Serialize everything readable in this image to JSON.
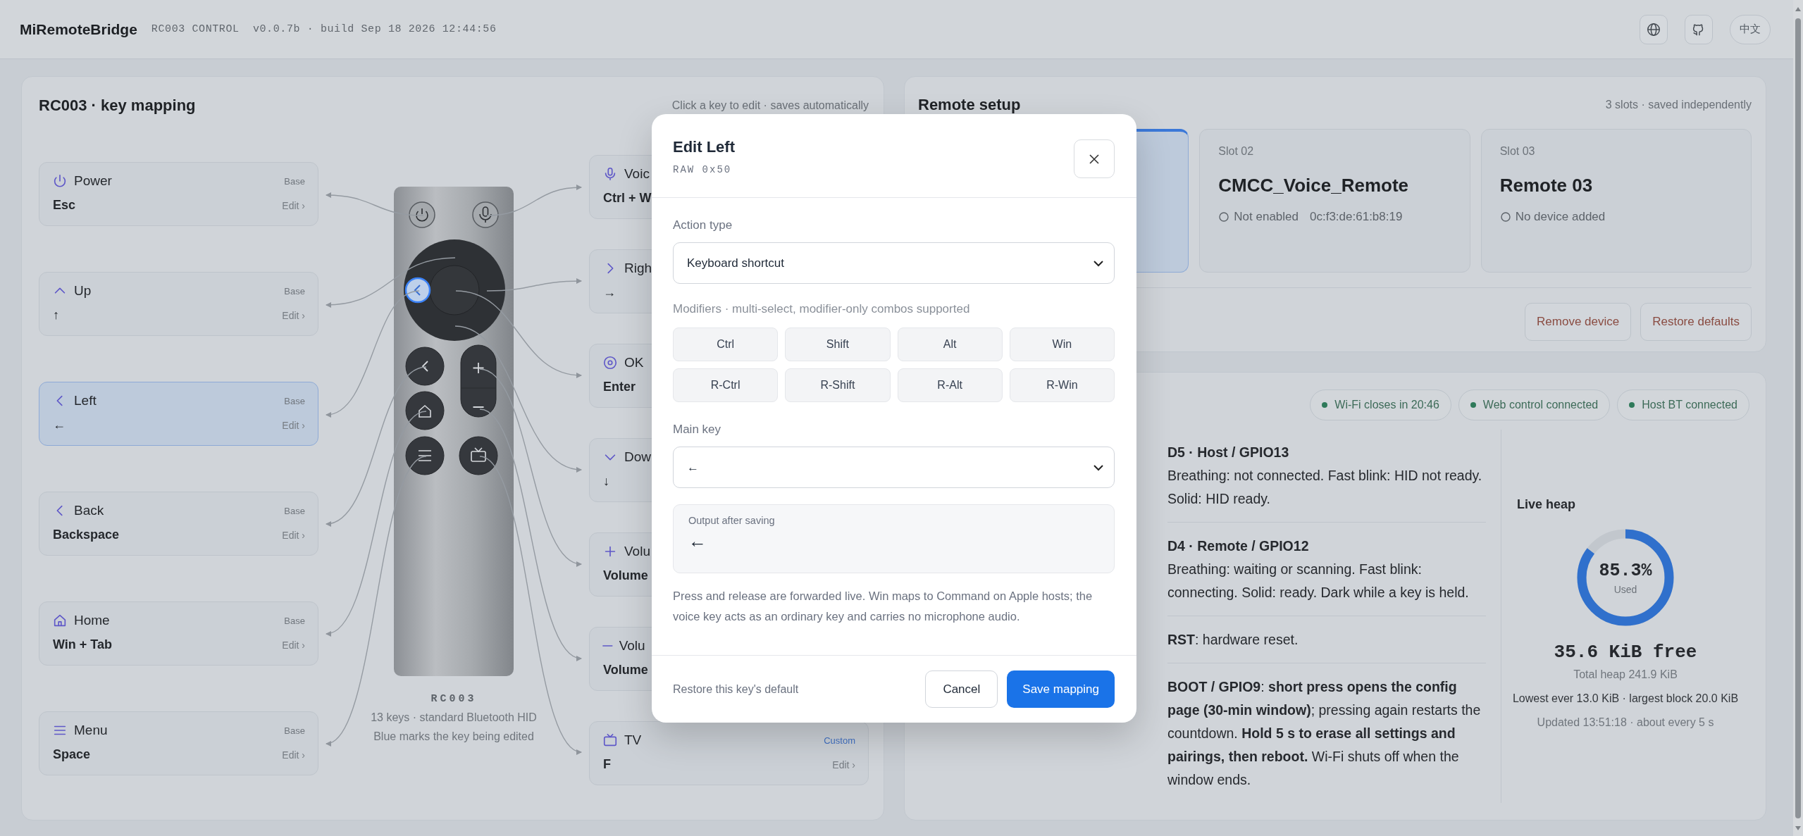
{
  "header": {
    "title": "MiRemoteBridge",
    "subtitle": "RC003 CONTROL  v0.0.7b · build Sep 18 2026 12:44:56",
    "language": "中文"
  },
  "mapping": {
    "title": "RC003 · key mapping",
    "hint": "Click a key to edit · saves automatically",
    "left_keys": [
      {
        "name": "Power",
        "value": "Esc",
        "tag": "Base",
        "custom": false,
        "edit": "Edit ›",
        "selected": false
      },
      {
        "name": "Up",
        "value": "↑",
        "tag": "Base",
        "custom": false,
        "edit": "Edit ›",
        "selected": false
      },
      {
        "name": "Left",
        "value": "←",
        "tag": "Base",
        "custom": false,
        "edit": "Edit ›",
        "selected": true
      },
      {
        "name": "Back",
        "value": "Backspace",
        "tag": "Base",
        "custom": false,
        "edit": "Edit ›",
        "selected": false
      },
      {
        "name": "Home",
        "value": "Win + Tab",
        "tag": "Base",
        "custom": false,
        "edit": "Edit ›",
        "selected": false
      },
      {
        "name": "Menu",
        "value": "Space",
        "tag": "Base",
        "custom": false,
        "edit": "Edit ›",
        "selected": false
      }
    ],
    "right_keys": [
      {
        "name": "Voic",
        "value": "Ctrl + W",
        "selected": false
      },
      {
        "name": "Righ",
        "value": "→",
        "selected": false
      },
      {
        "name": "OK",
        "value": "Enter",
        "selected": false
      },
      {
        "name": "Dow",
        "value": "↓",
        "selected": false
      },
      {
        "name": "Volu",
        "value": "Volume",
        "selected": false
      },
      {
        "name": "Volu",
        "value": "Volume",
        "selected": false
      },
      {
        "name": "TV",
        "value": "F",
        "tag": "Custom",
        "custom": true,
        "edit": "Edit ›",
        "selected": false
      }
    ],
    "remote": {
      "model": "RC003",
      "caption": "13 keys · standard Bluetooth HID",
      "note": "Blue marks the key being edited"
    }
  },
  "setup": {
    "title": "Remote setup",
    "hint": "3 slots · saved independently",
    "slots": [
      {
        "selected": true
      },
      {
        "label": "Slot 02",
        "name": "CMCC_Voice_Remote",
        "status": "Not enabled",
        "address": "0c:f3:de:61:b8:19",
        "selected": false
      },
      {
        "label": "Slot 03",
        "name": "Remote 03",
        "status": "No device added",
        "selected": false
      }
    ],
    "buttons": [
      "Remove device",
      "Restore defaults"
    ]
  },
  "status": {
    "pills": [
      "Wi-Fi closes in 20:46",
      "Web control connected",
      "Host BT connected"
    ],
    "leds": [
      {
        "title": "D5 · Host / GPIO13",
        "text": "Breathing: not connected. Fast blink: HID not ready. Solid: HID ready."
      },
      {
        "title": "D4 · Remote / GPIO12",
        "text": "Breathing: waiting or scanning. Fast blink: connecting. Solid: ready. Dark while a key is held."
      },
      {
        "text": "**RST**: hardware reset."
      },
      {
        "text": "**BOOT / GPIO9**: **short press opens the config page (30-min window)**; pressing again restarts the countdown. **Hold 5 s to erase all settings and pairings, then reboot.** Wi-Fi shuts off when the window ends."
      }
    ],
    "heap": {
      "title": "Live heap",
      "percent": "85.3%",
      "percent_label": "Used",
      "level": 0.853,
      "free": "35.6 KiB free",
      "total": "Total heap 241.9 KiB",
      "lowest": "Lowest ever 13.0 KiB · largest block 20.0 KiB",
      "updated": "Updated 13:51:18 · about every 5 s"
    }
  },
  "dialog": {
    "title": "Edit Left",
    "code": "RAW 0x50",
    "action_label": "Action type",
    "action_value": "Keyboard shortcut",
    "modifiers_label": "Modifiers · multi-select, modifier-only combos supported",
    "modifiers": [
      {
        "label": "Ctrl",
        "selected": false
      },
      {
        "label": "Shift",
        "selected": false
      },
      {
        "label": "Alt",
        "selected": false
      },
      {
        "label": "Win",
        "selected": false
      },
      {
        "label": "R-Ctrl",
        "selected": false
      },
      {
        "label": "R-Shift",
        "selected": false
      },
      {
        "label": "R-Alt",
        "selected": false
      },
      {
        "label": "R-Win",
        "selected": false
      }
    ],
    "main_key_label": "Main key",
    "main_key_value": "←",
    "output_label": "Output after saving",
    "output_value": "←",
    "note": "Press and release are forwarded live. Win maps to Command on Apple hosts; the voice key acts as an ordinary key and carries no microphone audio.",
    "restore": "Restore this key's default",
    "cancel": "Cancel",
    "save": "Save mapping"
  }
}
